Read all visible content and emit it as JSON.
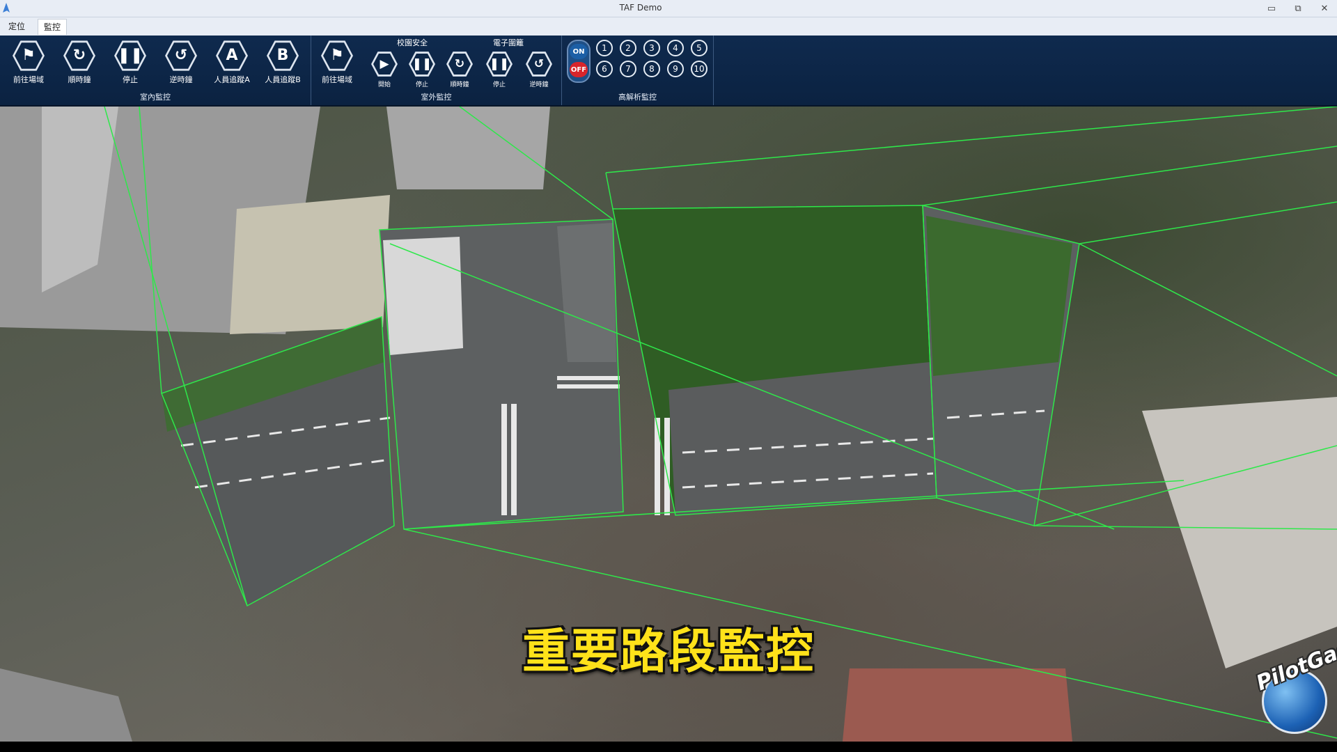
{
  "window": {
    "title": "TAF Demo",
    "controls": [
      "▭",
      "⧉",
      "✕"
    ]
  },
  "menu": {
    "tabs": [
      "定位",
      "監控"
    ],
    "active": "監控"
  },
  "ribbon": {
    "indoor": {
      "label": "室內監控",
      "buttons": [
        {
          "label": "前往場域",
          "icon": "⚑"
        },
        {
          "label": "順時鐘",
          "icon": "↻"
        },
        {
          "label": "停止",
          "icon": "❚❚"
        },
        {
          "label": "逆時鐘",
          "icon": "↺"
        },
        {
          "label": "人員追蹤A",
          "icon": "A"
        },
        {
          "label": "人員追蹤B",
          "icon": "B"
        }
      ]
    },
    "outdoor": {
      "label": "室外監控",
      "goto": {
        "label": "前往場域",
        "icon": "⚑"
      },
      "campus": {
        "label": "校園安全",
        "buttons": [
          {
            "label": "開始",
            "icon": "▶"
          },
          {
            "label": "停止",
            "icon": "❚❚"
          },
          {
            "label": "順時鐘",
            "icon": "↻"
          }
        ]
      },
      "fence": {
        "label": "電子圍籬",
        "buttons": [
          {
            "label": "停止",
            "icon": "❚❚"
          },
          {
            "label": "逆時鐘",
            "icon": "↺"
          }
        ]
      }
    },
    "hires": {
      "label": "高解析監控",
      "toggle": {
        "on": "ON",
        "off": "OFF"
      },
      "cameras": [
        "1",
        "2",
        "3",
        "4",
        "5",
        "6",
        "7",
        "8",
        "9",
        "10"
      ]
    }
  },
  "overlay": {
    "subtitle": "重要路段監控",
    "logo": "PilotGaea"
  }
}
